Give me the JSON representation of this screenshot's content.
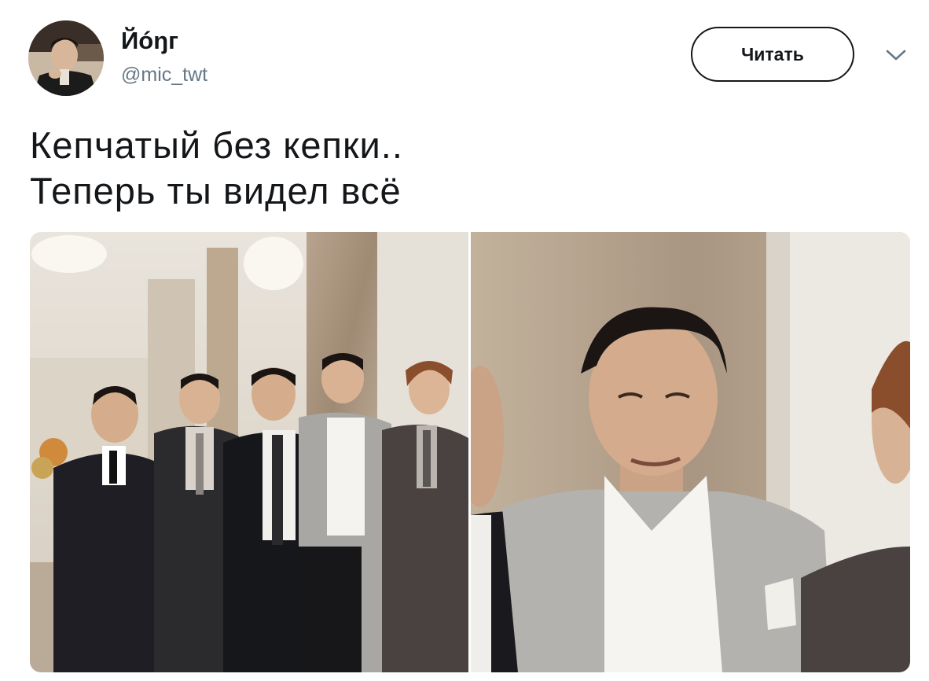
{
  "user": {
    "display_name": "Йóŋг",
    "handle": "@mic_twt",
    "avatar_icon": "profile-avatar"
  },
  "actions": {
    "follow_label": "Читать",
    "more_icon": "chevron-down-icon"
  },
  "tweet": {
    "lines": [
      "Кепчатый без кепки..",
      "Теперь ты видел всё"
    ]
  },
  "media": {
    "photos": [
      {
        "icon": "group-photo"
      },
      {
        "icon": "zoomed-photo"
      }
    ]
  },
  "colors": {
    "text": "#14171a",
    "secondary": "#657786",
    "border": "#14171a"
  }
}
